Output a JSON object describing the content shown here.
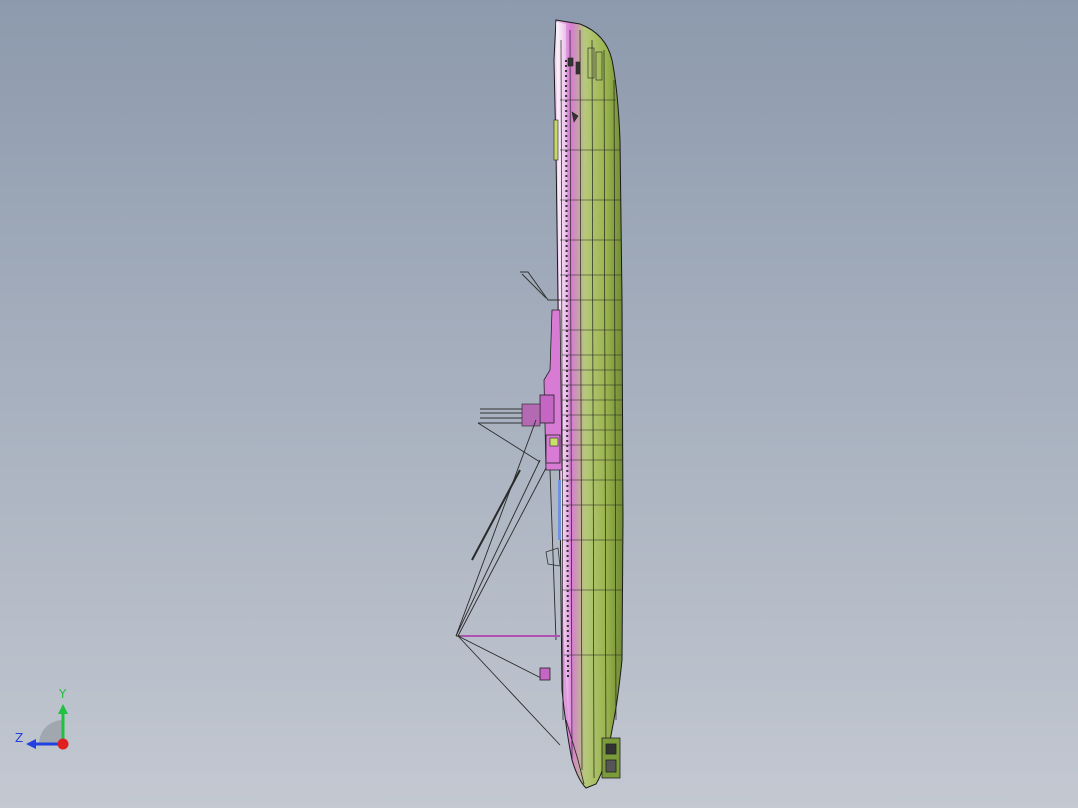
{
  "viewport": {
    "background_top": "#8d9aad",
    "background_bottom": "#c3c8d1"
  },
  "model": {
    "object": "ship-hull",
    "hull_green": "#9bb54f",
    "hull_magenta": "#d77bd4",
    "outline_color": "#1a1a1a"
  },
  "triad": {
    "x_color": "#e02020",
    "y_label": "Y",
    "y_color": "#20c040",
    "z_label": "Z",
    "z_color": "#2040e0"
  }
}
